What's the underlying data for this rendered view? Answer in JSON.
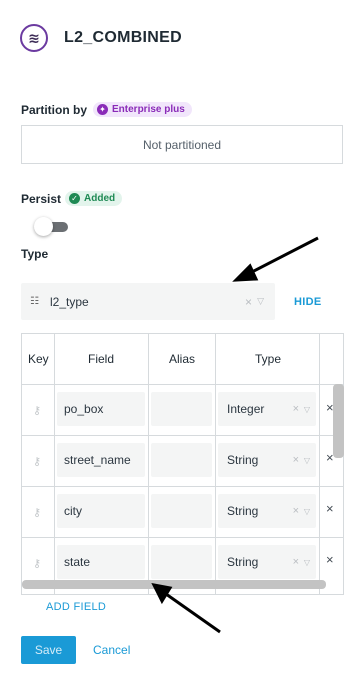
{
  "header": {
    "icon": "dataset-waves-icon",
    "title": "L2_COMBINED"
  },
  "partition": {
    "label": "Partition by",
    "badge": "Enterprise plus",
    "value": "Not partitioned"
  },
  "persist": {
    "label": "Persist",
    "badge": "Added",
    "toggle_on": false
  },
  "type": {
    "label": "Type",
    "selected": "l2_type",
    "clear_symbol": "×",
    "hide_label": "HIDE"
  },
  "table": {
    "headers": [
      "Key",
      "Field",
      "Alias",
      "Type"
    ],
    "rows": [
      {
        "field": "po_box",
        "alias": "",
        "type": "Integer"
      },
      {
        "field": "street_name",
        "alias": "",
        "type": "String"
      },
      {
        "field": "city",
        "alias": "",
        "type": "String"
      },
      {
        "field": "state",
        "alias": "",
        "type": "String"
      }
    ],
    "clear_symbol": "×",
    "delete_symbol": "×"
  },
  "add_field_label": "ADD FIELD",
  "actions": {
    "save_label": "Save",
    "cancel_label": "Cancel"
  },
  "colors": {
    "accent": "#1a9ad6",
    "enterprise": "#8a2bb8",
    "added": "#1f8a54"
  }
}
